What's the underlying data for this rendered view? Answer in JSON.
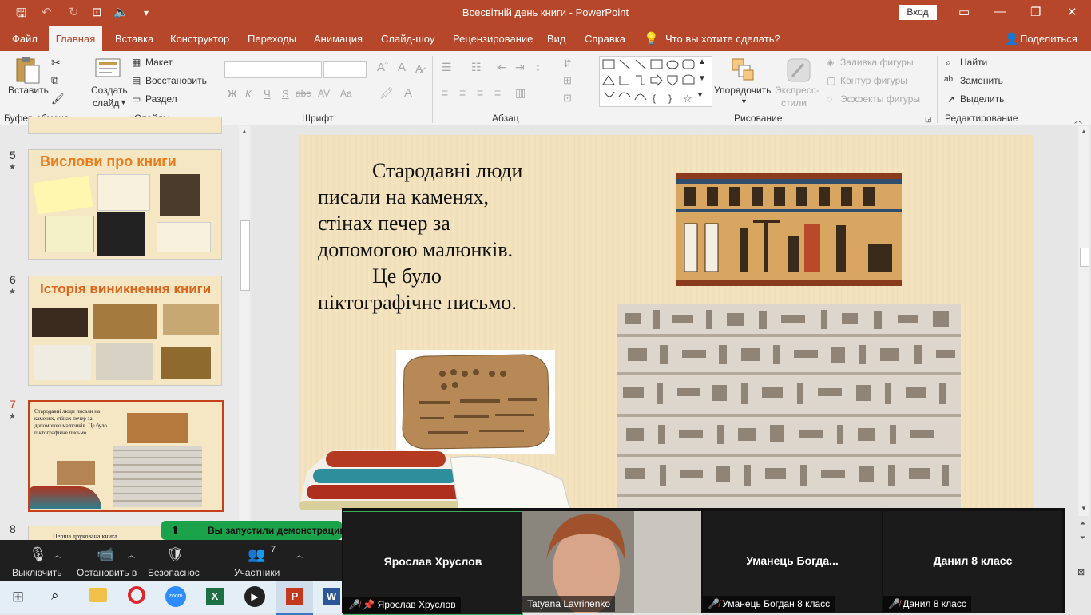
{
  "window": {
    "title": "Всесвітній день книги  -  PowerPoint",
    "signin": "Вход"
  },
  "tabs": [
    "Файл",
    "Главная",
    "Вставка",
    "Конструктор",
    "Переходы",
    "Анимация",
    "Слайд-шоу",
    "Рецензирование",
    "Вид",
    "Справка"
  ],
  "tell_me": "Что вы хотите сделать?",
  "share": "Поделиться",
  "ribbon": {
    "paste": "Вставить",
    "clipboard_group": "Буфер обмена",
    "new_slide_1": "Создать",
    "new_slide_2": "слайд",
    "layout": "Макет",
    "reset": "Восстановить",
    "section": "Раздел",
    "slides_group": "Слайды",
    "font_group": "Шрифт",
    "paragraph_group": "Абзац",
    "arrange": "Упорядочить",
    "quick_styles_1": "Экспресс-",
    "quick_styles_2": "стили",
    "shape_fill": "Заливка фигуры",
    "shape_outline": "Контур фигуры",
    "shape_effects": "Эффекты фигуры",
    "drawing_group": "Рисование",
    "find": "Найти",
    "replace": "Заменить",
    "select": "Выделить",
    "editing_group": "Редактирование",
    "bold": "Ж",
    "italic": "К",
    "underline": "Ч",
    "strike": "S",
    "shadow_abc": "abc",
    "spacing": "AV",
    "case": "Aa"
  },
  "thumbnails": [
    {
      "num": "5",
      "title": "Вислови про книги"
    },
    {
      "num": "6",
      "title": "Історія виникнення книги"
    },
    {
      "num": "7",
      "text": "Стародавні люди писали на  каменях, стінах печер за допомогою малюнків. Це було піктографічне письмо."
    },
    {
      "num": "8",
      "text": "Перша друкована книга"
    }
  ],
  "slide": {
    "lines": [
      "Стародавні люди",
      "писали на  каменях,",
      "стінах печер за",
      "допомогою малюнків.",
      "Це було",
      "піктографічне письмо."
    ]
  },
  "zoom": {
    "banner": "Вы запустили демонстрацию",
    "mute": "Выключить",
    "video": "Остановить в",
    "security": "Безопаснос",
    "participants": "Участники",
    "participants_count": "7",
    "tiles": [
      {
        "name": "Ярослав Хруслов",
        "label": "Ярослав Хруслов"
      },
      {
        "name": "",
        "label": "Tatyana Lavrinenko"
      },
      {
        "name": "Уманець  Богда...",
        "label": "Уманець Богдан 8 класс"
      },
      {
        "name": "Данил 8 класс",
        "label": "Данил 8 класс"
      }
    ]
  },
  "colors": {
    "accent": "#b7472a",
    "ribbon_bg": "#f3f3f3",
    "zoom_green": "#1aa34a"
  }
}
